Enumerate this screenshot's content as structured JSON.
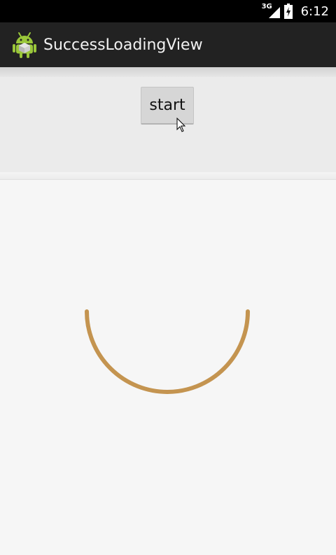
{
  "status_bar": {
    "network_type": "3G",
    "signal_icon": "signal-icon",
    "battery_icon": "battery-charging-icon",
    "time": "6:12"
  },
  "action_bar": {
    "app_icon": "android-icon",
    "title": "SuccessLoadingView"
  },
  "controls": {
    "start_label": "start"
  },
  "loading_view": {
    "arc_color": "#c49450",
    "arc_start_deg": 0,
    "arc_sweep_deg": 180
  },
  "colors": {
    "status_bar": "#000000",
    "action_bar": "#222222",
    "panel": "#ebebeb",
    "background": "#f6f6f6",
    "button": "#d6d6d6"
  }
}
